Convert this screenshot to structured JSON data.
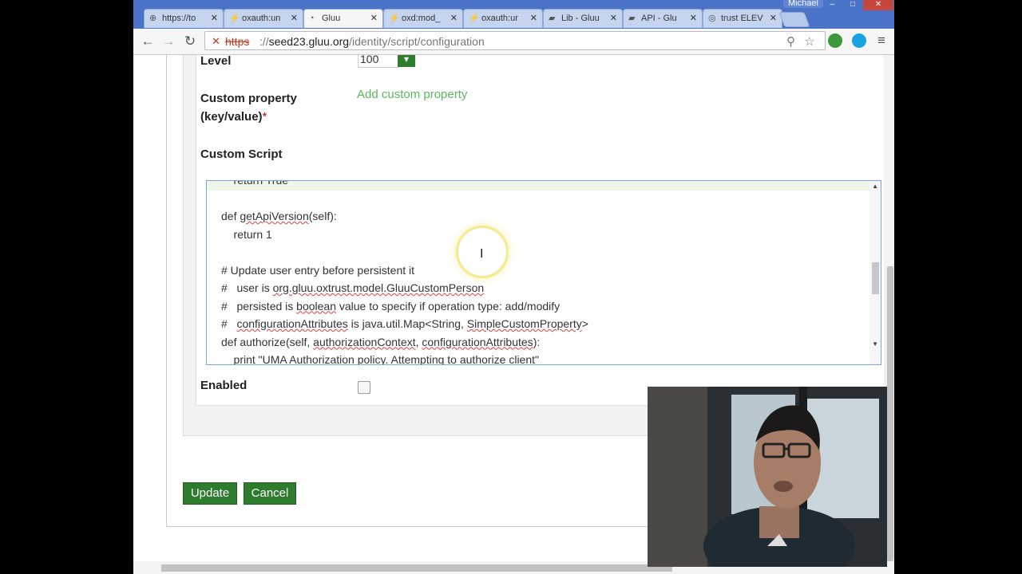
{
  "browser": {
    "user_name": "Michael",
    "window_controls": [
      "–",
      "□",
      "✕"
    ],
    "tabs": [
      {
        "label": "https://to",
        "icon": "globe-doc-icon",
        "glyph": "⊕",
        "close": "✕"
      },
      {
        "label": "oxauth:un",
        "icon": "git-icon",
        "glyph": "⚡",
        "close": "✕"
      },
      {
        "label": "Gluu",
        "icon": "gluu-page-icon",
        "glyph": "◔",
        "close": "✕",
        "active": true
      },
      {
        "label": "oxd:mod_",
        "icon": "git-icon",
        "glyph": "⚡",
        "close": "✕"
      },
      {
        "label": "oxauth:ur",
        "icon": "git-icon",
        "glyph": "⚡",
        "close": "✕"
      },
      {
        "label": "Lib - Gluu",
        "icon": "book-icon",
        "glyph": "▰",
        "close": "✕"
      },
      {
        "label": "API - Glu",
        "icon": "book-icon",
        "glyph": "▰",
        "close": "✕"
      },
      {
        "label": "trust ELEV",
        "icon": "globe-icon",
        "glyph": "◎",
        "close": "✕"
      }
    ],
    "url_scheme": "https",
    "url_host": "seed23.gluu.org",
    "url_path": "/identity/script/configuration",
    "nav_glyphs": {
      "back": "←",
      "forward": "→",
      "reload": "↻",
      "menu": "≡",
      "zoom": "⚲",
      "star": "☆",
      "insecure": "✕"
    }
  },
  "form": {
    "level_label": "Level",
    "level_value": "100",
    "custom_property_label_line1": "Custom property",
    "custom_property_label_line2": "(key/value)",
    "required_mark": "*",
    "add_custom_property": "Add custom property",
    "custom_script_label": "Custom Script",
    "enabled_label": "Enabled",
    "enabled_checked": false,
    "update_button": "Update",
    "cancel_button": "Cancel"
  },
  "script": {
    "cut_line": "    return True",
    "line_getapi_def": "def ",
    "line_getapi_name": "getApiVersion",
    "line_getapi_rest": "(self):",
    "line_return1": "    return 1",
    "line_comment1": "# Update user entry before persistent it",
    "line_comment2_a": "#   user is ",
    "line_comment2_b": "org.gluu.oxtrust.model.GluuCustomPerson",
    "line_comment3_a": "#   persisted is ",
    "line_comment3_b": "boolean",
    "line_comment3_c": " value to specify if operation type: add/modify",
    "line_comment4_a": "#   ",
    "line_comment4_b": "configurationAttributes",
    "line_comment4_c": " is java.util.Map<String, ",
    "line_comment4_d": "SimpleCustomProperty",
    "line_comment4_e": ">",
    "line_authorize_a": "def authorize(self, ",
    "line_authorize_b": "authorizationContext",
    "line_authorize_c": ", ",
    "line_authorize_d": "configurationAttributes",
    "line_authorize_e": "):",
    "line_print": "    print \"UMA Authorization policy. Attempting to authorize client\""
  },
  "colors": {
    "tabstrip": "#4b74c9",
    "green_button": "#2e7d2e",
    "link_green": "#5cb85c",
    "required_red": "#cc0000"
  }
}
